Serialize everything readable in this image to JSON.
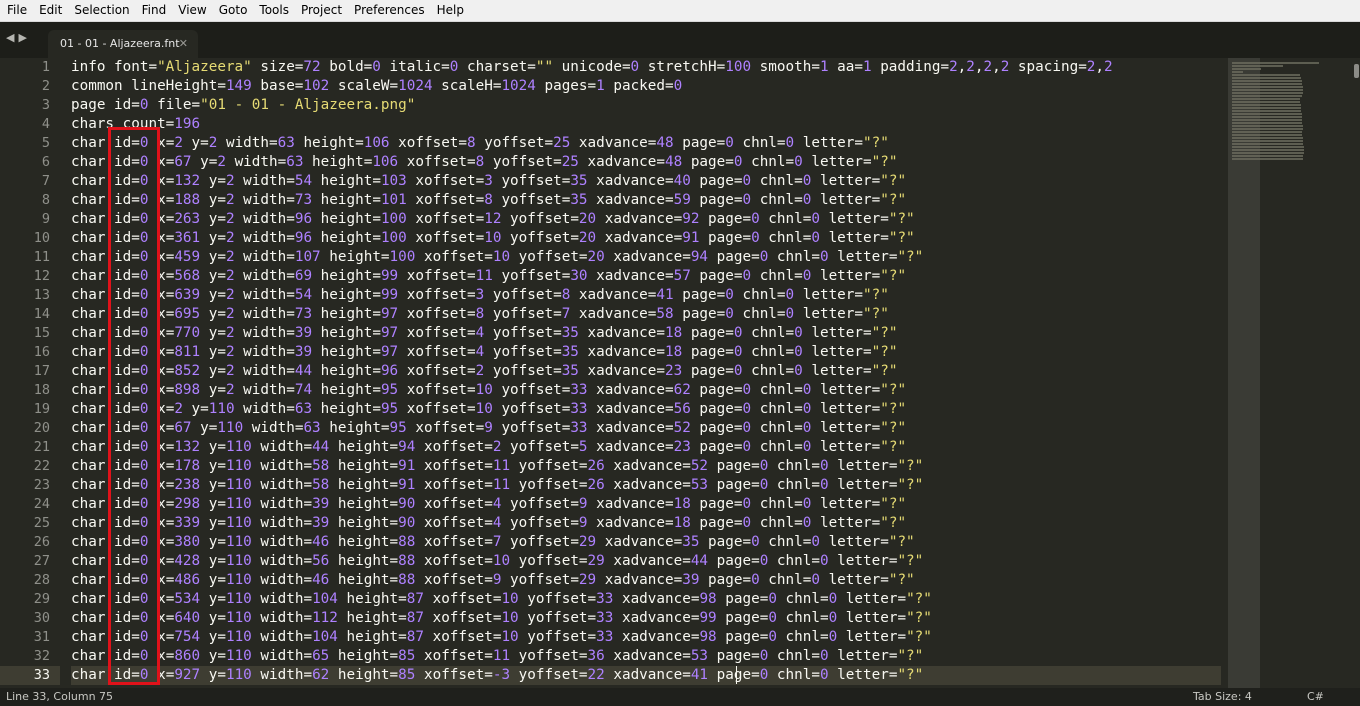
{
  "menu": [
    "File",
    "Edit",
    "Selection",
    "Find",
    "View",
    "Goto",
    "Tools",
    "Project",
    "Preferences",
    "Help"
  ],
  "tab": {
    "label": "01 - 01 - Aljazeera.fnt",
    "close": "✕"
  },
  "nav": {
    "back": "◀",
    "forward": "▶"
  },
  "editor": {
    "line_numbers": [
      "1",
      "2",
      "3",
      "4",
      "5",
      "6",
      "7",
      "8",
      "9",
      "10",
      "11",
      "12",
      "13",
      "14",
      "15",
      "16",
      "17",
      "18",
      "19",
      "20",
      "21",
      "22",
      "23",
      "24",
      "25",
      "26",
      "27",
      "28",
      "29",
      "30",
      "31",
      "32",
      "33"
    ],
    "active_line": 33,
    "lines": [
      "info font=\"Aljazeera\" size=72 bold=0 italic=0 charset=\"\" unicode=0 stretchH=100 smooth=1 aa=1 padding=2,2,2,2 spacing=2,2",
      "common lineHeight=149 base=102 scaleW=1024 scaleH=1024 pages=1 packed=0",
      "page id=0 file=\"01 - 01 - Aljazeera.png\"",
      "chars count=196",
      "char id=0 x=2 y=2 width=63 height=106 xoffset=8 yoffset=25 xadvance=48 page=0 chnl=0 letter=\"?\"",
      "char id=0 x=67 y=2 width=63 height=106 xoffset=8 yoffset=25 xadvance=48 page=0 chnl=0 letter=\"?\"",
      "char id=0 x=132 y=2 width=54 height=103 xoffset=3 yoffset=35 xadvance=40 page=0 chnl=0 letter=\"?\"",
      "char id=0 x=188 y=2 width=73 height=101 xoffset=8 yoffset=35 xadvance=59 page=0 chnl=0 letter=\"?\"",
      "char id=0 x=263 y=2 width=96 height=100 xoffset=12 yoffset=20 xadvance=92 page=0 chnl=0 letter=\"?\"",
      "char id=0 x=361 y=2 width=96 height=100 xoffset=10 yoffset=20 xadvance=91 page=0 chnl=0 letter=\"?\"",
      "char id=0 x=459 y=2 width=107 height=100 xoffset=10 yoffset=20 xadvance=94 page=0 chnl=0 letter=\"?\"",
      "char id=0 x=568 y=2 width=69 height=99 xoffset=11 yoffset=30 xadvance=57 page=0 chnl=0 letter=\"?\"",
      "char id=0 x=639 y=2 width=54 height=99 xoffset=3 yoffset=8 xadvance=41 page=0 chnl=0 letter=\"?\"",
      "char id=0 x=695 y=2 width=73 height=97 xoffset=8 yoffset=7 xadvance=58 page=0 chnl=0 letter=\"?\"",
      "char id=0 x=770 y=2 width=39 height=97 xoffset=4 yoffset=35 xadvance=18 page=0 chnl=0 letter=\"?\"",
      "char id=0 x=811 y=2 width=39 height=97 xoffset=4 yoffset=35 xadvance=18 page=0 chnl=0 letter=\"?\"",
      "char id=0 x=852 y=2 width=44 height=96 xoffset=2 yoffset=35 xadvance=23 page=0 chnl=0 letter=\"?\"",
      "char id=0 x=898 y=2 width=74 height=95 xoffset=10 yoffset=33 xadvance=62 page=0 chnl=0 letter=\"?\"",
      "char id=0 x=2 y=110 width=63 height=95 xoffset=10 yoffset=33 xadvance=56 page=0 chnl=0 letter=\"?\"",
      "char id=0 x=67 y=110 width=63 height=95 xoffset=9 yoffset=33 xadvance=52 page=0 chnl=0 letter=\"?\"",
      "char id=0 x=132 y=110 width=44 height=94 xoffset=2 yoffset=5 xadvance=23 page=0 chnl=0 letter=\"?\"",
      "char id=0 x=178 y=110 width=58 height=91 xoffset=11 yoffset=26 xadvance=52 page=0 chnl=0 letter=\"?\"",
      "char id=0 x=238 y=110 width=58 height=91 xoffset=11 yoffset=26 xadvance=53 page=0 chnl=0 letter=\"?\"",
      "char id=0 x=298 y=110 width=39 height=90 xoffset=4 yoffset=9 xadvance=18 page=0 chnl=0 letter=\"?\"",
      "char id=0 x=339 y=110 width=39 height=90 xoffset=4 yoffset=9 xadvance=18 page=0 chnl=0 letter=\"?\"",
      "char id=0 x=380 y=110 width=46 height=88 xoffset=7 yoffset=29 xadvance=35 page=0 chnl=0 letter=\"?\"",
      "char id=0 x=428 y=110 width=56 height=88 xoffset=10 yoffset=29 xadvance=44 page=0 chnl=0 letter=\"?\"",
      "char id=0 x=486 y=110 width=46 height=88 xoffset=9 yoffset=29 xadvance=39 page=0 chnl=0 letter=\"?\"",
      "char id=0 x=534 y=110 width=104 height=87 xoffset=10 yoffset=33 xadvance=98 page=0 chnl=0 letter=\"?\"",
      "char id=0 x=640 y=110 width=112 height=87 xoffset=10 yoffset=33 xadvance=99 page=0 chnl=0 letter=\"?\"",
      "char id=0 x=754 y=110 width=104 height=87 xoffset=10 yoffset=33 xadvance=98 page=0 chnl=0 letter=\"?\"",
      "char id=0 x=860 y=110 width=65 height=85 xoffset=11 yoffset=36 xadvance=53 page=0 chnl=0 letter=\"?\"",
      "char id=0 x=927 y=110 width=62 height=85 xoffset=-3 yoffset=22 xadvance=41 page=0 chnl=0 letter=\"?\""
    ]
  },
  "status": {
    "position": "Line 33, Column 75",
    "tab_size": "Tab Size: 4",
    "syntax": "C#"
  },
  "colors": {
    "background": "#272822",
    "number": "#ae81ff",
    "string": "#e6db74",
    "highlight_box": "#e0121a"
  }
}
